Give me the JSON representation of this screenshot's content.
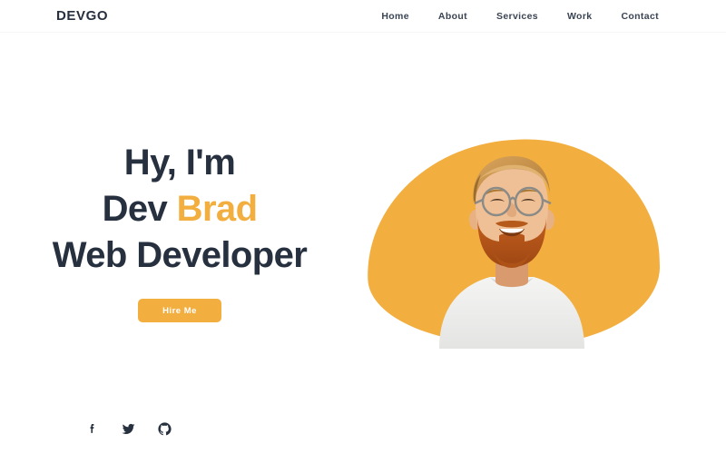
{
  "header": {
    "logo": "DEVGO",
    "nav": [
      {
        "label": "Home",
        "name": "nav-link-home"
      },
      {
        "label": "About",
        "name": "nav-link-about"
      },
      {
        "label": "Services",
        "name": "nav-link-services"
      },
      {
        "label": "Work",
        "name": "nav-link-work"
      },
      {
        "label": "Contact",
        "name": "nav-link-contact"
      }
    ]
  },
  "hero": {
    "line1": "Hy, I'm",
    "line2_prefix": "Dev ",
    "line2_accent": "Brad",
    "line3": "Web Developer",
    "cta_label": "Hire Me",
    "portrait_alt": "Smiling bearded man with round glasses wearing a white sweatshirt"
  },
  "socials": [
    {
      "label": "Facebook",
      "icon": "facebook-icon"
    },
    {
      "label": "Twitter",
      "icon": "twitter-icon"
    },
    {
      "label": "GitHub",
      "icon": "github-icon"
    }
  ],
  "colors": {
    "accent": "#f2ae3e",
    "ink": "#26303f",
    "nav_text": "#3a4453",
    "background": "#ffffff",
    "header_border": "#f4f5f7",
    "button_text": "#ffffff"
  }
}
